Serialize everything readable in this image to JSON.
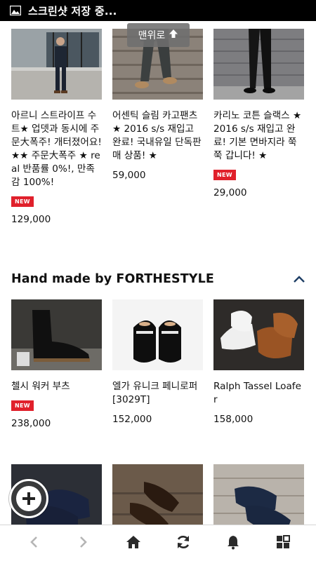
{
  "status_bar": {
    "text": "스크린샷 저장 중..."
  },
  "scroll_top": {
    "label": "맨위로"
  },
  "products_top": [
    {
      "name": "아르니 스트라이프 수트★ 업뎃과 동시에 주문大폭주! 개터졌어요! ★★ 주문大폭주 ★ real 반품률 0%!, 만족감 100%!",
      "badge": "NEW",
      "price": "129,000",
      "image": "man-in-suit-photo"
    },
    {
      "name": "어센틱 슬림 카고팬츠★ 2016 s/s 재입고 완료! 국내유일 단독판매 상품! ★",
      "badge": "",
      "price": "59,000",
      "image": "cargo-pants-photo"
    },
    {
      "name": "카리노 코튼 슬랙스 ★ 2016 s/s 재입고 완료! 기본 면바지라 쭉쭉 갑니다! ★",
      "badge": "NEW",
      "price": "29,000",
      "image": "slacks-photo"
    }
  ],
  "section": {
    "title": "Hand made by FORTHESTYLE",
    "toggle_icon": "chevron-up-icon"
  },
  "products_handmade": [
    {
      "name": "첼시 워커 부츠",
      "badge": "NEW",
      "price": "238,000",
      "image": "chelsea-boots-photo"
    },
    {
      "name": "엘가 유니크 페니로퍼 [3029T]",
      "badge": "",
      "price": "152,000",
      "image": "penny-loafer-photo"
    },
    {
      "name": "Ralph Tassel Loafer",
      "badge": "",
      "price": "158,000",
      "image": "tassel-loafer-photo"
    }
  ],
  "products_row3": [
    {
      "image": "navy-loafer-photo"
    },
    {
      "image": "brown-loafer-photo"
    },
    {
      "image": "suede-loafer-photo"
    }
  ],
  "fab": {
    "icon": "plus-icon"
  },
  "bottom_bar": {
    "items": [
      {
        "icon": "back-icon"
      },
      {
        "icon": "forward-icon"
      },
      {
        "icon": "home-icon"
      },
      {
        "icon": "refresh-icon"
      },
      {
        "icon": "bell-icon"
      },
      {
        "icon": "grid-icon"
      }
    ]
  },
  "colors": {
    "badge": "#e0202b",
    "status_bar": "#000000",
    "text": "#111111",
    "chevron": "#1f3f66"
  }
}
